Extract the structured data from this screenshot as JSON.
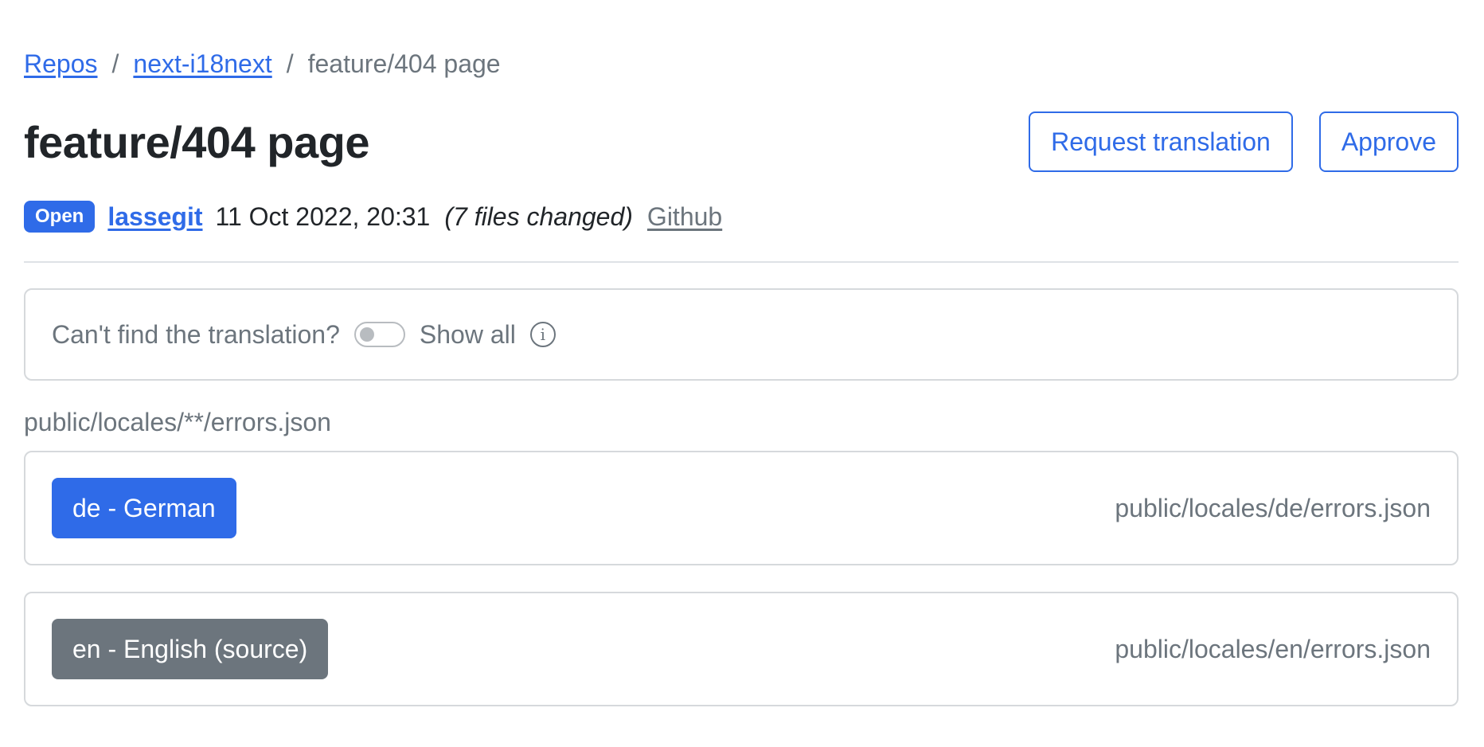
{
  "breadcrumb": {
    "repos": "Repos",
    "repo": "next-i18next",
    "current": "feature/404 page",
    "separator": "/"
  },
  "page_title": "feature/404 page",
  "actions": {
    "request_translation": "Request translation",
    "approve": "Approve"
  },
  "meta": {
    "status": "Open",
    "author": "lassegit",
    "date": "11 Oct 2022, 20:31",
    "files_changed": "(7 files changed)",
    "github": "Github"
  },
  "filter": {
    "label": "Can't find the translation?",
    "toggle_label": "Show all",
    "toggle_on": false,
    "info_icon": "info-icon"
  },
  "section": {
    "pattern": "public/locales/**/errors.json",
    "locales": [
      {
        "label": "de - German",
        "path": "public/locales/de/errors.json",
        "style": "primary"
      },
      {
        "label": "en - English (source)",
        "path": "public/locales/en/errors.json",
        "style": "secondary"
      }
    ]
  },
  "colors": {
    "accent": "#2f6be8",
    "muted": "#6c757d",
    "border": "#d6d9dc"
  }
}
